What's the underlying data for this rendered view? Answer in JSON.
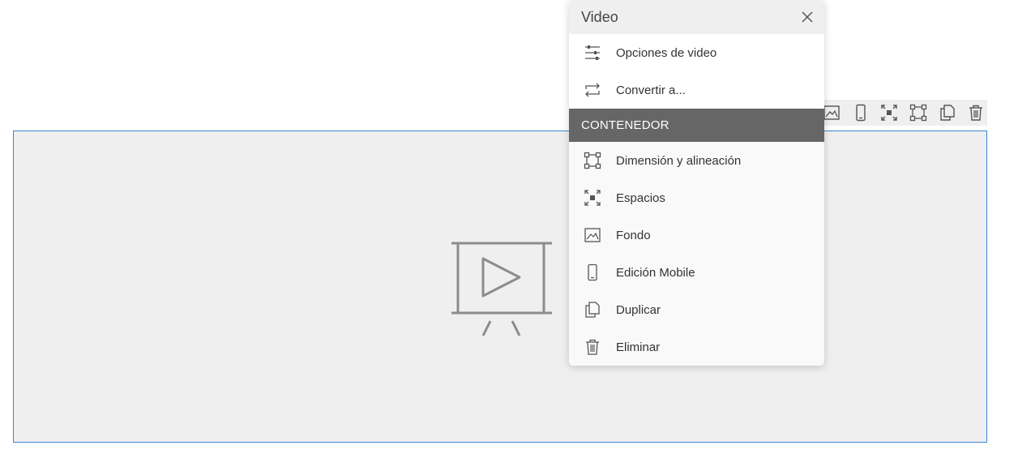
{
  "menu": {
    "title": "Video",
    "items": [
      {
        "label": "Opciones de video",
        "icon": "sliders-icon"
      },
      {
        "label": "Convertir a...",
        "icon": "convert-arrows-icon"
      }
    ],
    "section": {
      "title": "CONTENEDOR",
      "items": [
        {
          "label": "Dimensión y alineación",
          "icon": "dimension-icon"
        },
        {
          "label": "Espacios",
          "icon": "spacing-icon"
        },
        {
          "label": "Fondo",
          "icon": "background-image-icon"
        },
        {
          "label": "Edición Mobile",
          "icon": "mobile-icon"
        },
        {
          "label": "Duplicar",
          "icon": "duplicate-icon"
        },
        {
          "label": "Eliminar",
          "icon": "trash-icon"
        }
      ]
    }
  },
  "toolbar": {
    "icons": [
      "background-image-icon",
      "mobile-icon",
      "spacing-icon",
      "dimension-icon",
      "duplicate-icon",
      "trash-icon"
    ]
  },
  "video_block": {
    "placeholder_icon": "video-projector-icon"
  },
  "colors": {
    "selection_border": "#3b86d6",
    "section_header_bg": "#666666",
    "block_bg": "#efefef"
  }
}
